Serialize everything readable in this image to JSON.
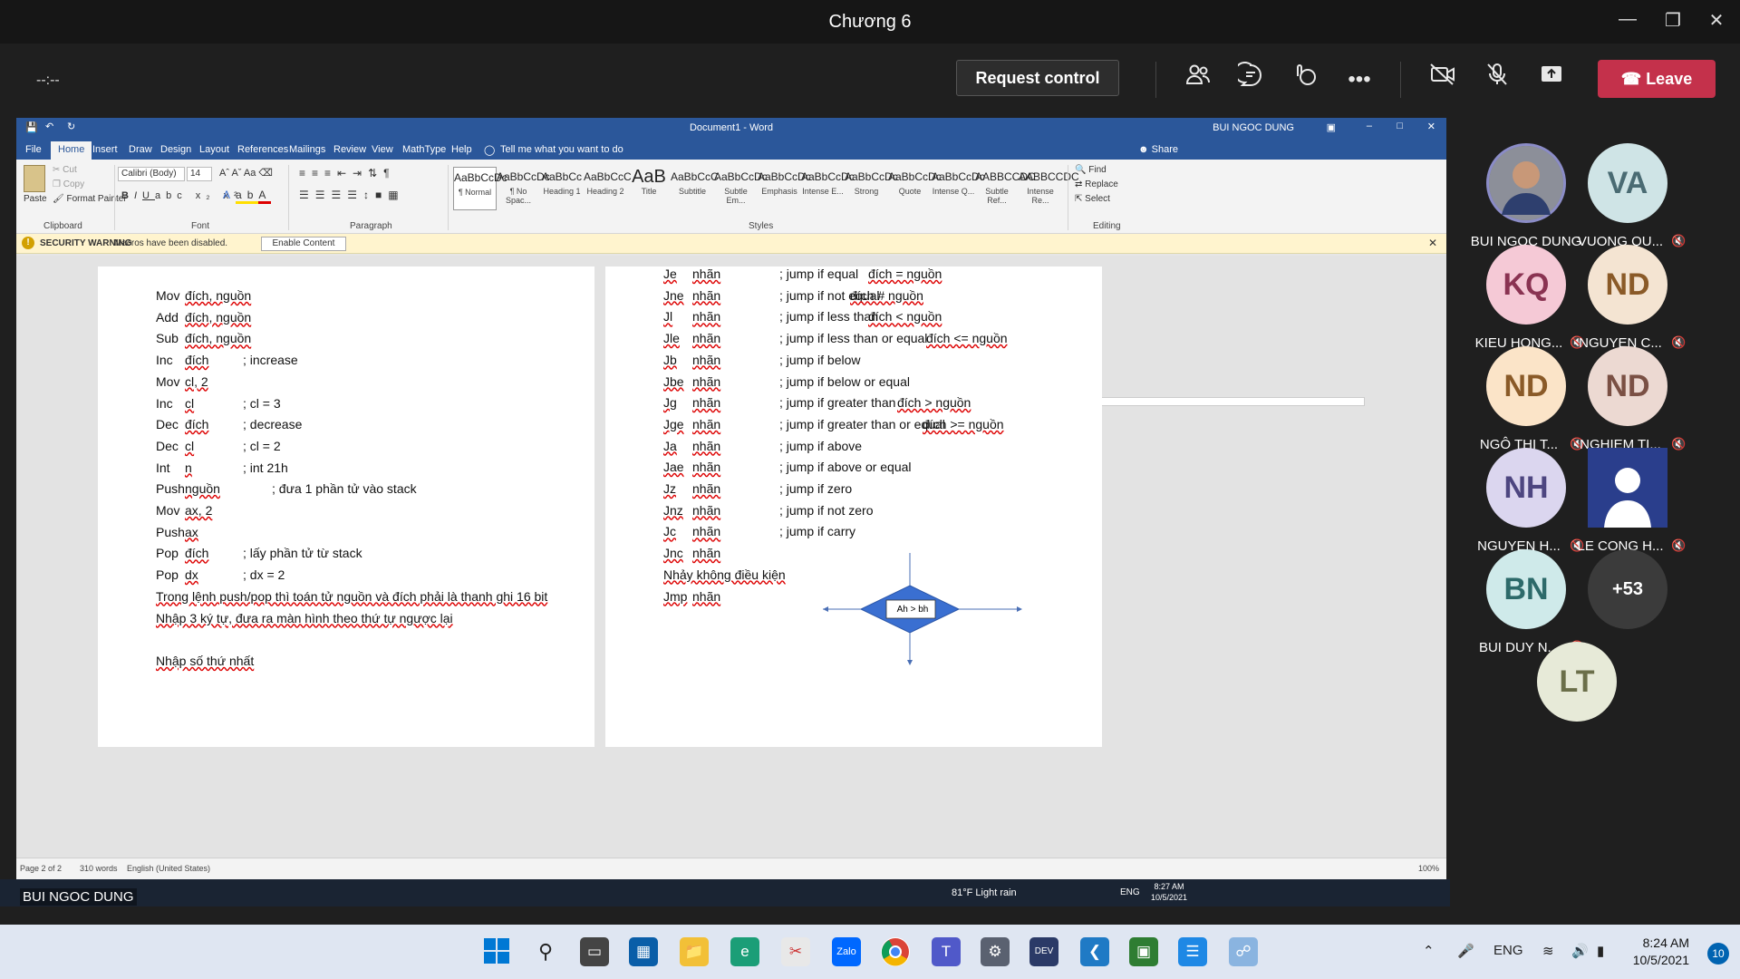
{
  "teams": {
    "title": "Chương 6",
    "timer": "--:--",
    "request_control": "Request control",
    "leave": "Leave",
    "presenter": "BUI NGOC DUNG"
  },
  "word": {
    "doc_title": "Document1 - Word",
    "user": "BUI NGOC DUNG",
    "share": "Share",
    "tell_me": "Tell me what you want to do",
    "tabs": [
      "File",
      "Home",
      "Insert",
      "Draw",
      "Design",
      "Layout",
      "References",
      "Mailings",
      "Review",
      "View",
      "MathType",
      "Help"
    ],
    "clipboard": {
      "paste": "Paste",
      "cut": "Cut",
      "copy": "Copy",
      "format_painter": "Format Painter",
      "label": "Clipboard"
    },
    "font": {
      "name": "Calibri (Body)",
      "size": "14",
      "label": "Font"
    },
    "paragraph_label": "Paragraph",
    "styles_label": "Styles",
    "editing": {
      "find": "Find",
      "replace": "Replace",
      "select": "Select",
      "label": "Editing"
    },
    "styles": [
      {
        "preview": "AaBbCcDc",
        "label": "¶ Normal"
      },
      {
        "preview": "AaBbCcDc",
        "label": "¶ No Spac..."
      },
      {
        "preview": "AaBbCc",
        "label": "Heading 1"
      },
      {
        "preview": "AaBbCcC",
        "label": "Heading 2"
      },
      {
        "preview": "AaB",
        "label": "Title"
      },
      {
        "preview": "AaBbCcC",
        "label": "Subtitle"
      },
      {
        "preview": "AaBbCcDc",
        "label": "Subtle Em..."
      },
      {
        "preview": "AaBbCcDc",
        "label": "Emphasis"
      },
      {
        "preview": "AaBbCcDc",
        "label": "Intense E..."
      },
      {
        "preview": "AaBbCcDc",
        "label": "Strong"
      },
      {
        "preview": "AaBbCcDc",
        "label": "Quote"
      },
      {
        "preview": "AaBbCcDc",
        "label": "Intense Q..."
      },
      {
        "preview": "AABBCCDC",
        "label": "Subtle Ref..."
      },
      {
        "preview": "AABBCCDC",
        "label": "Intense Re..."
      }
    ],
    "security": {
      "title": "SECURITY WARNING",
      "message": "Macros have been disabled.",
      "button": "Enable Content"
    },
    "status": {
      "page": "Page 2 of 2",
      "words": "310 words",
      "language": "English (United States)",
      "zoom": "100%"
    },
    "left_lines": [
      [
        "Mov",
        "đích, nguồn",
        ""
      ],
      [
        "Add",
        "đích, nguồn",
        ""
      ],
      [
        "Sub",
        "đích, nguồn",
        ""
      ],
      [
        "Inc",
        "đích",
        "; increase"
      ],
      [
        "Mov",
        "cl, 2",
        ""
      ],
      [
        "Inc",
        "cl",
        "; cl = 3"
      ],
      [
        "Dec",
        "đích",
        "; decrease"
      ],
      [
        "Dec",
        "cl",
        "; cl = 2"
      ],
      [
        "Int",
        "n",
        "; int 21h"
      ],
      [
        "Push",
        "nguồn",
        "; đưa 1 phần tử vào stack"
      ],
      [
        "Mov",
        "ax, 2",
        ""
      ],
      [
        "Push",
        "ax",
        ""
      ],
      [
        "Pop",
        "đích",
        "; lấy phần tử từ stack"
      ],
      [
        "Pop",
        "dx",
        "; dx = 2"
      ]
    ],
    "left_paragraphs": [
      "Trong lệnh push/pop thì toán tử nguồn và đích phải là thanh ghi 16 bit",
      "Nhập 3 ký tự, đưa ra màn hình theo thứ tự ngược lại",
      "Nhập số thứ nhất"
    ],
    "right_lines": [
      [
        "Je",
        "nhãn",
        "; jump if equal",
        "đích = nguồn"
      ],
      [
        "Jne",
        "nhãn",
        "; jump if not equal",
        "đích # nguồn"
      ],
      [
        "Jl",
        "nhãn",
        "; jump if less than",
        "đích < nguồn"
      ],
      [
        "Jle",
        "nhãn",
        "; jump if less than or equal",
        "đích <= nguồn"
      ],
      [
        "Jb",
        "nhãn",
        "; jump if below",
        ""
      ],
      [
        "Jbe",
        "nhãn",
        "; jump if below or equal",
        ""
      ],
      [
        "Jg",
        "nhãn",
        "; jump if greater than",
        "đích > nguồn"
      ],
      [
        "Jge",
        "nhãn",
        "; jump if greater than or equal",
        "đích >= nguồn"
      ],
      [
        "Ja",
        "nhãn",
        "; jump if above",
        ""
      ],
      [
        "Jae",
        "nhãn",
        "; jump if above or equal",
        ""
      ],
      [
        "Jz",
        "nhãn",
        "; jump if zero",
        ""
      ],
      [
        "Jnz",
        "nhãn",
        "; jump if not zero",
        ""
      ],
      [
        "Jc",
        "nhãn",
        "; jump if carry",
        ""
      ],
      [
        "Jnc",
        "nhãn",
        "",
        ""
      ]
    ],
    "right_heading": "Nhảy không điều kiện",
    "right_jmp": [
      "Jmp",
      "nhãn"
    ],
    "diamond_text": "Ah > bh",
    "inner_taskbar": {
      "weather": "81°F  Light rain",
      "lang": "ENG",
      "time": "8:27 AM",
      "date": "10/5/2021"
    }
  },
  "participants": [
    {
      "initials": "",
      "name": "BUI NGOC DUNG",
      "color": "#6b6f80",
      "muted": false
    },
    {
      "initials": "VA",
      "name": "VUONG QU...",
      "color": "#cfe4e6",
      "fg": "#4a6b73",
      "muted": true
    },
    {
      "initials": "KQ",
      "name": "KIEU HONG...",
      "color": "#f5c9d6",
      "fg": "#8a3352",
      "muted": true
    },
    {
      "initials": "ND",
      "name": "NGUYEN C...",
      "color": "#f4e4d2",
      "fg": "#8a5a28",
      "muted": true
    },
    {
      "initials": "ND",
      "name": "NGÔ THỊ T...",
      "color": "#fbe4c8",
      "fg": "#8a5a28",
      "muted": true
    },
    {
      "initials": "ND",
      "name": "NGHIEM TI...",
      "color": "#ecd9d2",
      "fg": "#7a5044",
      "muted": true
    },
    {
      "initials": "NH",
      "name": "NGUYEN H...",
      "color": "#dbd6ef",
      "fg": "#4d4680",
      "muted": true
    },
    {
      "initials": "",
      "name": "LE CONG H...",
      "color": "#2a3e8c",
      "muted": true
    },
    {
      "initials": "BN",
      "name": "BUI DUY N...",
      "color": "#cfeaea",
      "fg": "#2d6a6a",
      "muted": true
    },
    {
      "initials": "+53",
      "name": "",
      "color": "#3b3b3b",
      "fg": "#ffffff",
      "muted": false
    },
    {
      "initials": "LT",
      "name": "",
      "color": "#e7ead8",
      "fg": "#6b6f4a",
      "muted": false
    }
  ],
  "taskbar": {
    "lang": "ENG",
    "time": "8:24 AM",
    "date": "10/5/2021",
    "notifications": "10"
  }
}
